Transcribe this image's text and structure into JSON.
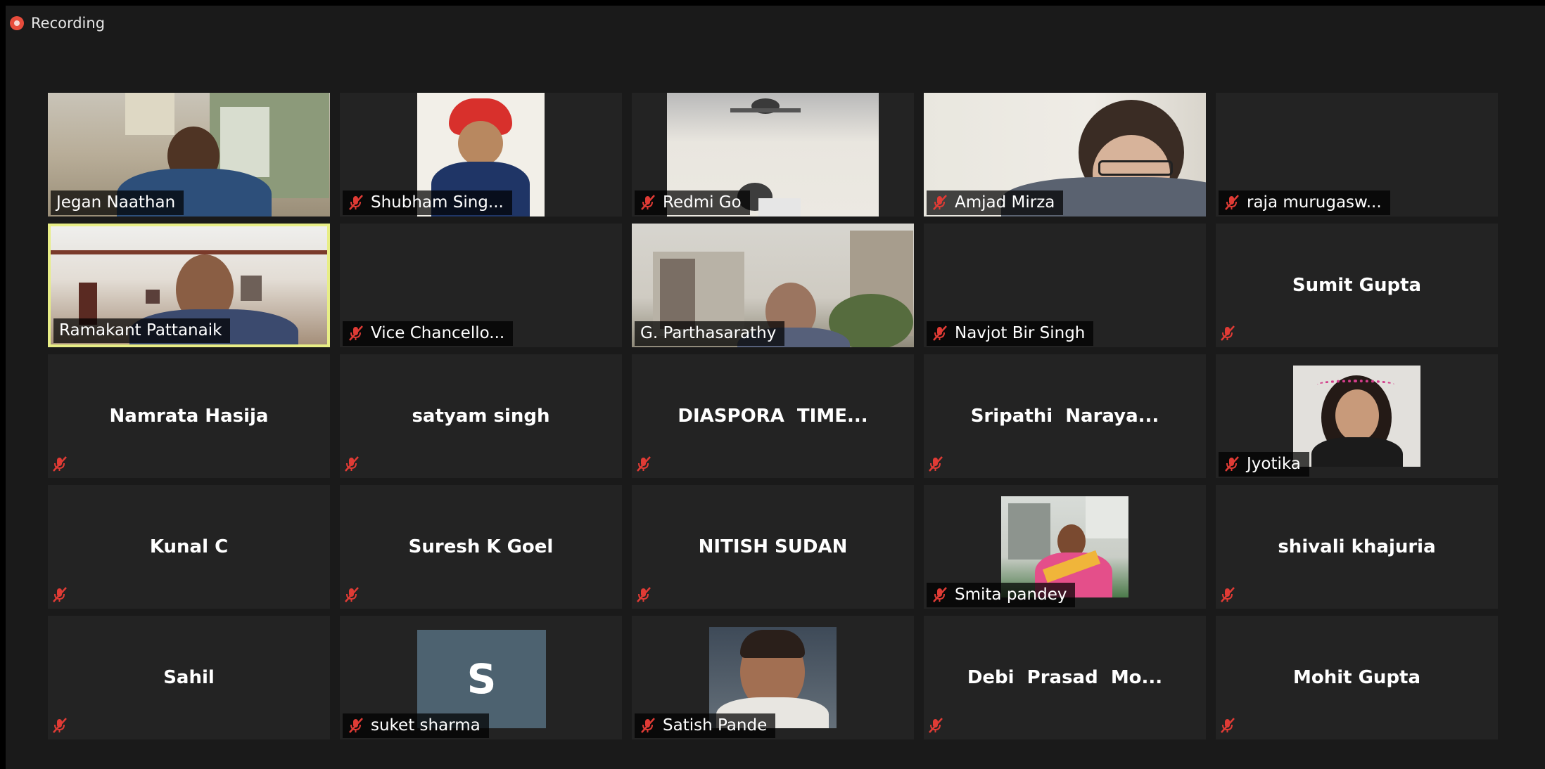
{
  "recording": {
    "label": "Recording"
  },
  "colors": {
    "active_border": "#e8ee86",
    "recording_red": "#e74c3c",
    "avatar_bg": "#4d6270"
  },
  "participants": [
    {
      "name": "Jegan Naathan"
    },
    {
      "name": "Shubham Sing..."
    },
    {
      "name": "Redmi Go"
    },
    {
      "name": "Amjad Mirza"
    },
    {
      "name": "raja murugasw..."
    },
    {
      "name": "Ramakant Pattanaik"
    },
    {
      "name": "Vice Chancello..."
    },
    {
      "name": "G. Parthasarathy"
    },
    {
      "name": "Navjot Bir Singh"
    },
    {
      "name": "Sumit Gupta"
    },
    {
      "name": "Namrata Hasija"
    },
    {
      "name": "satyam singh"
    },
    {
      "name": "DIASPORA  TIME..."
    },
    {
      "name": "Sripathi  Naraya..."
    },
    {
      "name": "Jyotika"
    },
    {
      "name": "Kunal C"
    },
    {
      "name": "Suresh K Goel"
    },
    {
      "name": "NITISH SUDAN"
    },
    {
      "name": "Smita pandey"
    },
    {
      "name": "shivali khajuria"
    },
    {
      "name": "Sahil"
    },
    {
      "name": "suket sharma",
      "avatar_letter": "S"
    },
    {
      "name": "Satish Pande"
    },
    {
      "name": "Debi  Prasad  Mo..."
    },
    {
      "name": "Mohit Gupta"
    }
  ]
}
